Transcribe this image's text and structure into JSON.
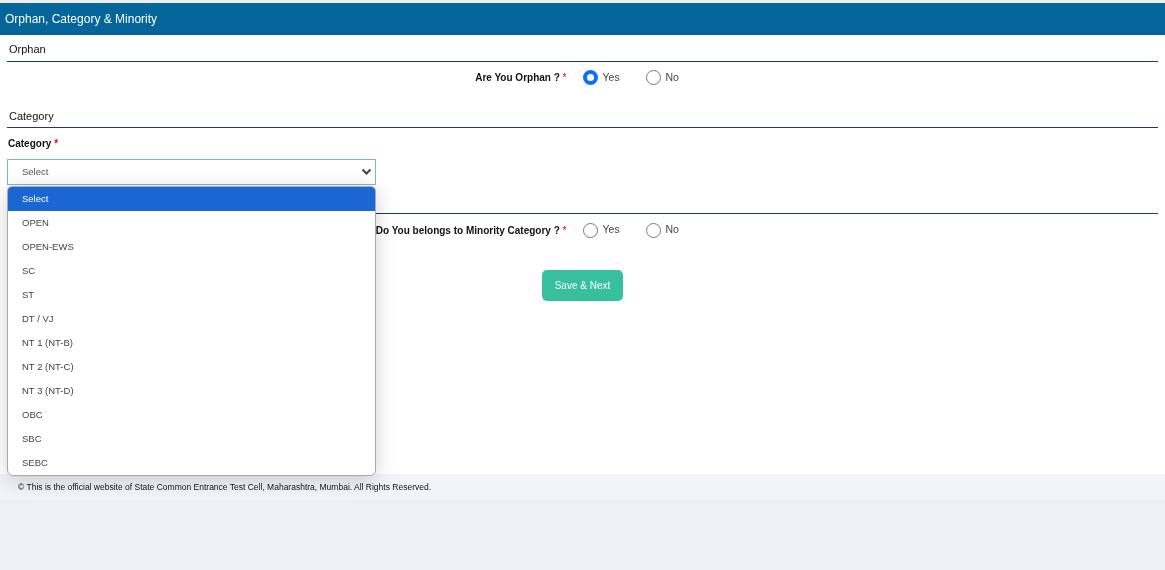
{
  "header": {
    "title": "Orphan, Category & Minority"
  },
  "orphan": {
    "heading": "Orphan",
    "question": "Are You Orphan ?",
    "required": "*",
    "options": [
      {
        "label": "Yes",
        "selected": true
      },
      {
        "label": "No",
        "selected": false
      }
    ]
  },
  "category": {
    "heading": "Category",
    "label": "Category",
    "required": "*",
    "select": {
      "value": "Select",
      "expanded": true
    },
    "options": [
      {
        "label": "Select",
        "selected": true
      },
      {
        "label": "OPEN",
        "selected": false
      },
      {
        "label": "OPEN-EWS",
        "selected": false
      },
      {
        "label": "SC",
        "selected": false
      },
      {
        "label": "ST",
        "selected": false
      },
      {
        "label": "DT / VJ",
        "selected": false
      },
      {
        "label": "NT 1 (NT-B)",
        "selected": false
      },
      {
        "label": "NT 2 (NT-C)",
        "selected": false
      },
      {
        "label": "NT 3 (NT-D)",
        "selected": false
      },
      {
        "label": "OBC",
        "selected": false
      },
      {
        "label": "SBC",
        "selected": false
      },
      {
        "label": "SEBC",
        "selected": false
      }
    ]
  },
  "minority": {
    "question": "Do You belongs to Minority Category ?",
    "required": "*",
    "options": [
      {
        "label": "Yes",
        "selected": false
      },
      {
        "label": "No",
        "selected": false
      }
    ]
  },
  "save_button": "Save & Next",
  "footer": "© This is the official website of State Common Entrance Test Cell, Maharashtra, Mumbai. All Rights Reserved."
}
